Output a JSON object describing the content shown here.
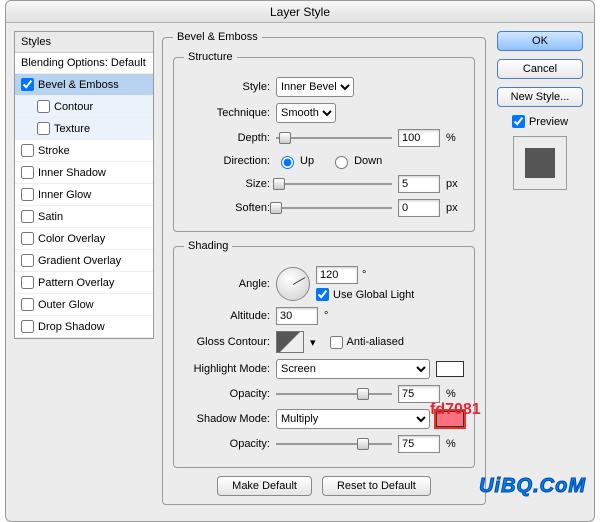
{
  "title": "Layer Style",
  "styles_header": "Styles",
  "blending_label": "Blending Options: Default",
  "styles": {
    "bevel": "Bevel & Emboss",
    "contour": "Contour",
    "texture": "Texture",
    "stroke": "Stroke",
    "innerShadow": "Inner Shadow",
    "innerGlow": "Inner Glow",
    "satin": "Satin",
    "colorOverlay": "Color Overlay",
    "gradientOverlay": "Gradient Overlay",
    "patternOverlay": "Pattern Overlay",
    "outerGlow": "Outer Glow",
    "dropShadow": "Drop Shadow"
  },
  "group_bevel": "Bevel & Emboss",
  "group_structure": "Structure",
  "group_shading": "Shading",
  "labels": {
    "style": "Style:",
    "technique": "Technique:",
    "depth": "Depth:",
    "direction": "Direction:",
    "up": "Up",
    "down": "Down",
    "size": "Size:",
    "soften": "Soften:",
    "angle": "Angle:",
    "altitude": "Altitude:",
    "useGlobal": "Use Global Light",
    "glossContour": "Gloss Contour:",
    "antialiased": "Anti-aliased",
    "highlightMode": "Highlight Mode:",
    "opacity": "Opacity:",
    "shadowMode": "Shadow Mode:"
  },
  "values": {
    "style": "Inner Bevel",
    "technique": "Smooth",
    "depth": "100",
    "depthUnit": "%",
    "size": "5",
    "sizeUnit": "px",
    "soften": "0",
    "softenUnit": "px",
    "angle": "120",
    "angleUnit": "°",
    "altitude": "30",
    "altitudeUnit": "°",
    "highlightMode": "Screen",
    "highlightOpacity": "75",
    "shadowMode": "Multiply",
    "shadowOpacity": "75",
    "opacityUnit": "%"
  },
  "buttons": {
    "ok": "OK",
    "cancel": "Cancel",
    "newStyle": "New Style...",
    "preview": "Preview",
    "makeDefault": "Make Default",
    "resetDefault": "Reset to Default"
  },
  "annotation": "fd7081",
  "watermark": "UiBQ.CoM"
}
